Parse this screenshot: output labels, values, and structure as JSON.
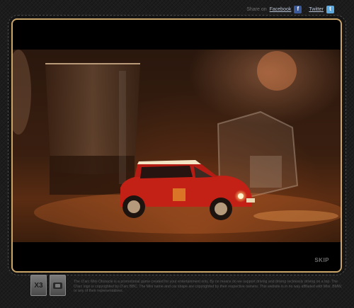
{
  "share": {
    "label": "Share on",
    "facebook_label": "Facebook",
    "twitter_label": "Twitter",
    "facebook_icon": "facebook-icon",
    "twitter_icon": "twitter-icon"
  },
  "player": {
    "skip_label": "SKIP",
    "accent_color": "#c9a56a"
  },
  "footer": {
    "disclaimer": "The O'arc Mini Obstacle is a promotional game created for your entertainment only. By no means do we support driving and driving recklessly driving on a top. The O'arc logo is copyrighted by O'arc BBC. The Mini name and car shape are copyrighted by their respective owners. This website is in no way affiliated with Mini, BMW, or any of their representatives."
  },
  "tiles": {
    "x3_label": "X3",
    "logo_icon": "brand-logo-icon"
  }
}
